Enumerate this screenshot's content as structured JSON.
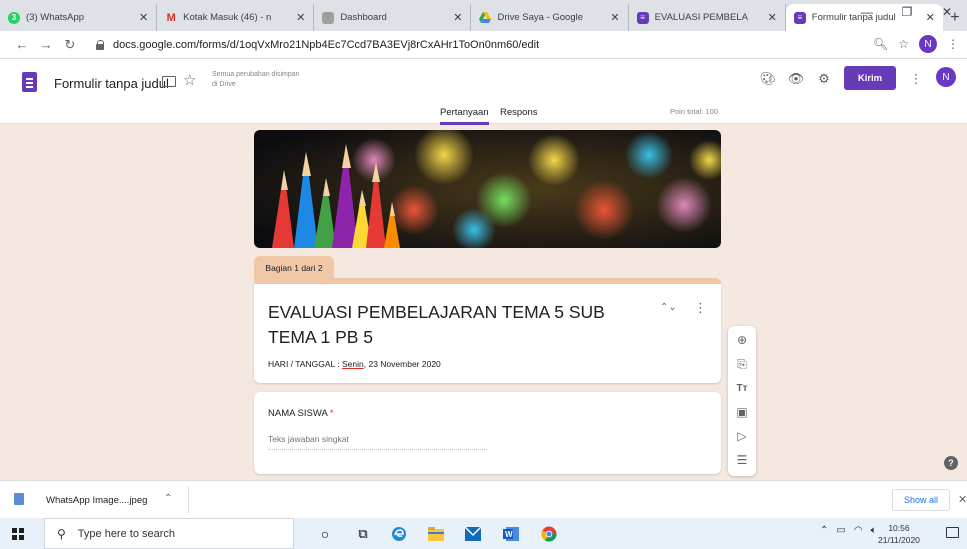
{
  "browser": {
    "tabs": [
      {
        "title": "(3) WhatsApp",
        "color": "#25d366",
        "glyph": "3"
      },
      {
        "title": "Kotak Masuk (46) - n",
        "color": "#ffffff",
        "glyph": "M"
      },
      {
        "title": "Dashboard",
        "color": "#9e9e9e",
        "glyph": ""
      },
      {
        "title": "Drive Saya - Google",
        "color": "#fbbc04",
        "glyph": ""
      },
      {
        "title": "EVALUASI PEMBELA",
        "color": "#673ab7",
        "glyph": ""
      },
      {
        "title": "Formulir tanpa judul",
        "color": "#673ab7",
        "glyph": ""
      }
    ],
    "new_tab": "+",
    "url": "docs.google.com/forms/d/1oqVxMro21Npb4Ec7Ccd7BA3EVj8rCxAHr1ToOn0nm60/edit",
    "profile_initial": "N"
  },
  "forms": {
    "title": "Formulir tanpa judul",
    "saved_line1": "Semua perubahan disimpan",
    "saved_line2": "di Drive",
    "send_label": "Kirim",
    "avatar_initial": "N",
    "tabs": {
      "questions": "Pertanyaan",
      "responses": "Respons"
    },
    "points_total": "Poin total: 100",
    "section_label": "Bagian 1 dari 2",
    "section_title": "EVALUASI PEMBELAJARAN TEMA 5 SUB TEMA 1 PB 5",
    "description_prefix": "HARI / TANGGAL : ",
    "description_day": "Senin",
    "description_rest": ", 23 November 2020",
    "question_label": "NAMA SISWA",
    "required_mark": "*",
    "answer_placeholder": "Teks jawaban singkat",
    "accent": "#673ab7",
    "section_color": "#f0c8a8"
  },
  "downloads": {
    "file_name": "WhatsApp Image....jpeg",
    "show_all": "Show all"
  },
  "taskbar": {
    "search_placeholder": "Type here to search",
    "time": "10:56",
    "date": "21/11/2020"
  }
}
